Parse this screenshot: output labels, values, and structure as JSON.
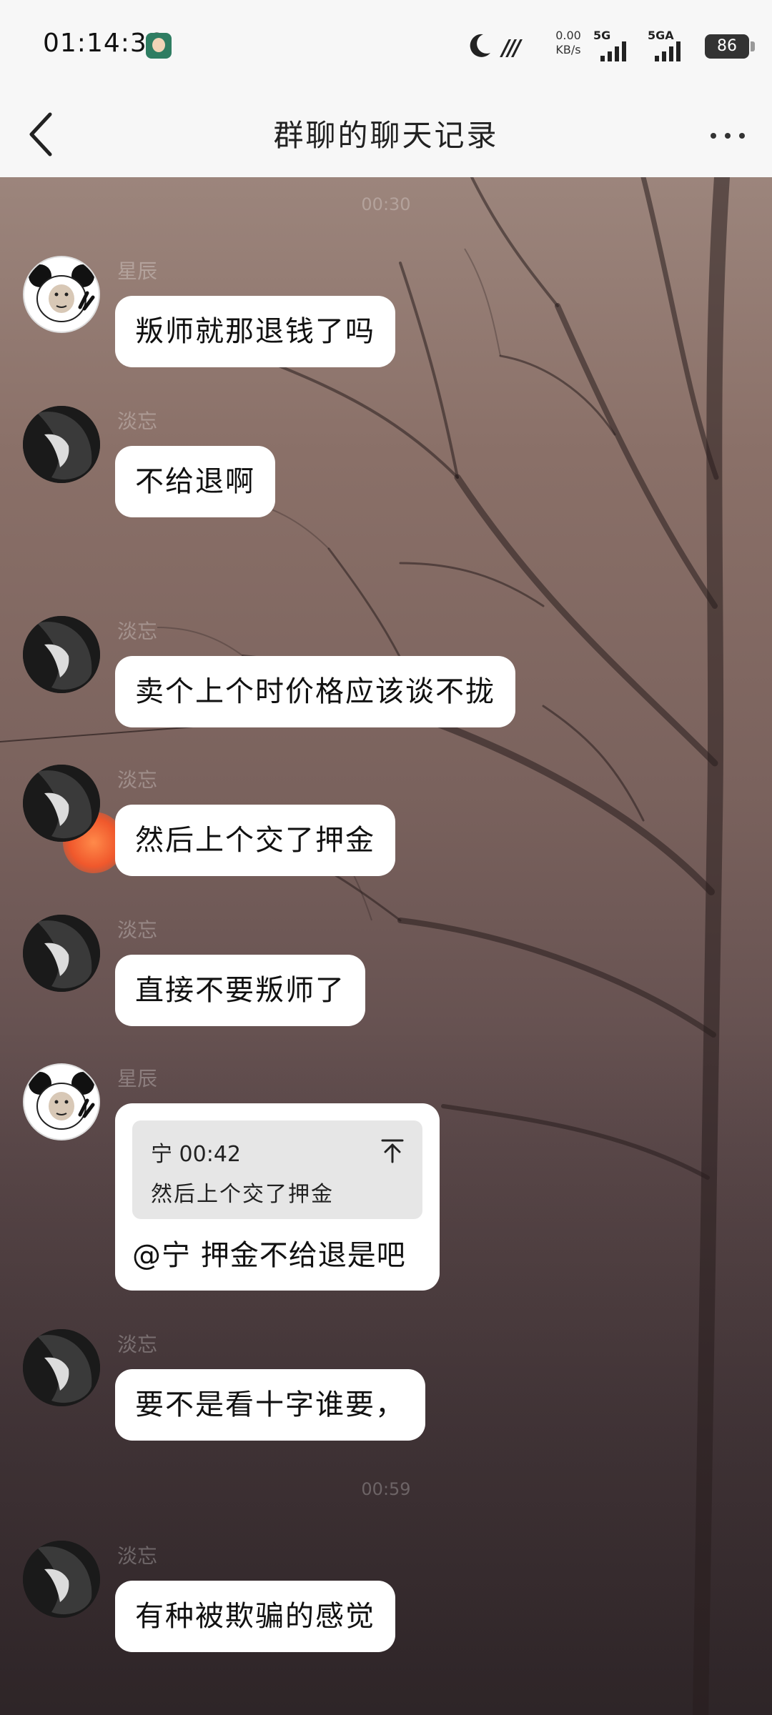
{
  "status_bar": {
    "time": "01:14:36",
    "net_speed_value": "0.00",
    "net_speed_unit": "KB/s",
    "sim1_label": "5G",
    "sim2_label": "5GA",
    "battery": "86"
  },
  "header": {
    "title": "群聊的聊天记录"
  },
  "time_separators": [
    "00:30",
    "00:59"
  ],
  "messages": [
    {
      "sender": "星辰",
      "text": "叛师就那退钱了吗",
      "avatar": "panda"
    },
    {
      "sender": "淡忘",
      "text": "不给退啊",
      "avatar": "dark"
    },
    {
      "sender": "淡忘",
      "text": "卖个上个时价格应该谈不拢",
      "avatar": "dark"
    },
    {
      "sender": "淡忘",
      "text": "然后上个交了押金",
      "avatar": "dark"
    },
    {
      "sender": "淡忘",
      "text": "直接不要叛师了",
      "avatar": "dark"
    },
    {
      "sender": "星辰",
      "avatar": "panda",
      "quote": {
        "meta": "宁 00:42",
        "text": "然后上个交了押金"
      },
      "text": "@宁 押金不给退是吧"
    },
    {
      "sender": "淡忘",
      "text": "要不是看十字谁要，",
      "avatar": "dark"
    },
    {
      "sender": "淡忘",
      "text": "有种被欺骗的感觉",
      "avatar": "dark"
    }
  ]
}
